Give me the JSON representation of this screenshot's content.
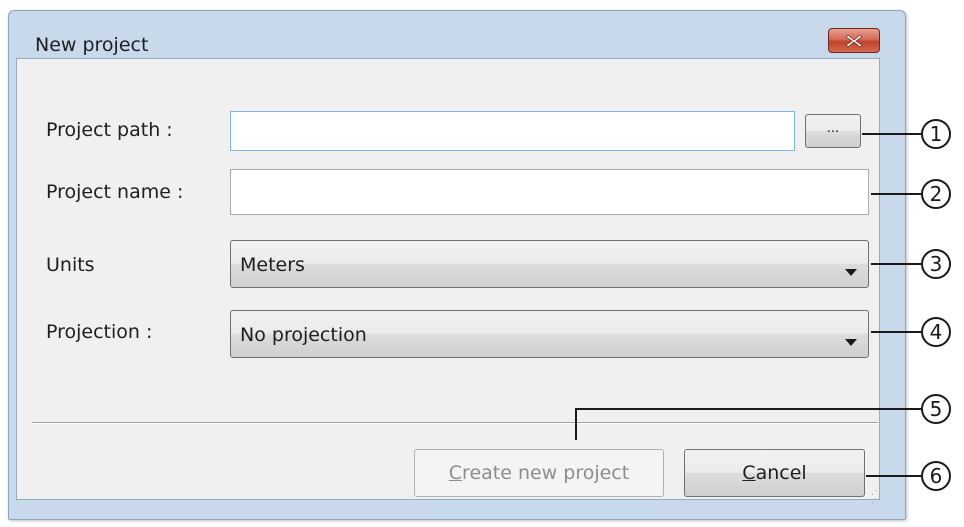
{
  "window": {
    "title": "New project",
    "close_icon": "close-icon"
  },
  "form": {
    "project_path_label": "Project path :",
    "project_path_value": "",
    "browse_label": "...",
    "project_name_label": "Project name :",
    "project_name_value": "",
    "units_label": "Units",
    "units_value": "Meters",
    "projection_label": "Projection :",
    "projection_value": "No projection"
  },
  "buttons": {
    "create_label_accel": "C",
    "create_label_rest": "reate new project",
    "cancel_label_accel": "C",
    "cancel_label_rest": "ancel"
  },
  "callouts": [
    "1",
    "2",
    "3",
    "4",
    "5",
    "6"
  ],
  "colors": {
    "window_frame": "#c9d9ec",
    "client_bg": "#f0f0f0",
    "close_button": "#c7503b"
  }
}
